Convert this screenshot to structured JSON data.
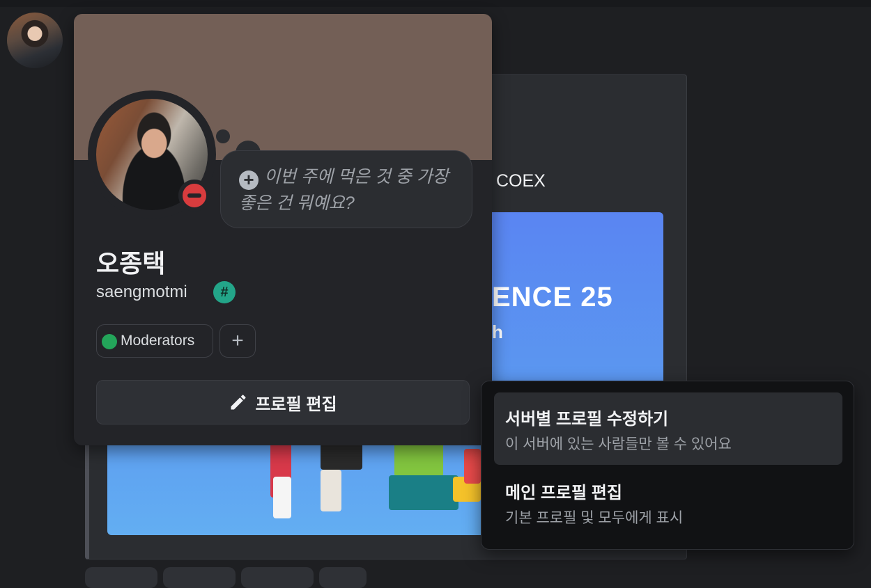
{
  "background": {
    "embed_title": "일 COEX",
    "embed_image_text": "ENCE 25",
    "embed_image_subtext": "h"
  },
  "profile": {
    "display_name": "오종택",
    "username": "saengmotmi",
    "badge_icon": "#",
    "status_prompt": "이번 주에 먹은 것 중 가장 좋은 건 뭐예요?",
    "status": "do-not-disturb",
    "roles": [
      {
        "label": "Moderators",
        "color": "#23a55a"
      }
    ],
    "add_role_icon": "+",
    "edit_button_label": "프로필 편집"
  },
  "menu": {
    "items": [
      {
        "title": "서버별 프로필 수정하기",
        "subtitle": "이 서버에 있는 사람들만 볼 수 있어요",
        "highlighted": true
      },
      {
        "title": "메인 프로필 편집",
        "subtitle": "기본 프로필 및 모두에게 표시",
        "highlighted": false
      }
    ]
  },
  "colors": {
    "banner": "#735f56",
    "accent_green": "#23a55a",
    "dnd_red": "#d83c3e",
    "badge_teal": "#23a589"
  }
}
